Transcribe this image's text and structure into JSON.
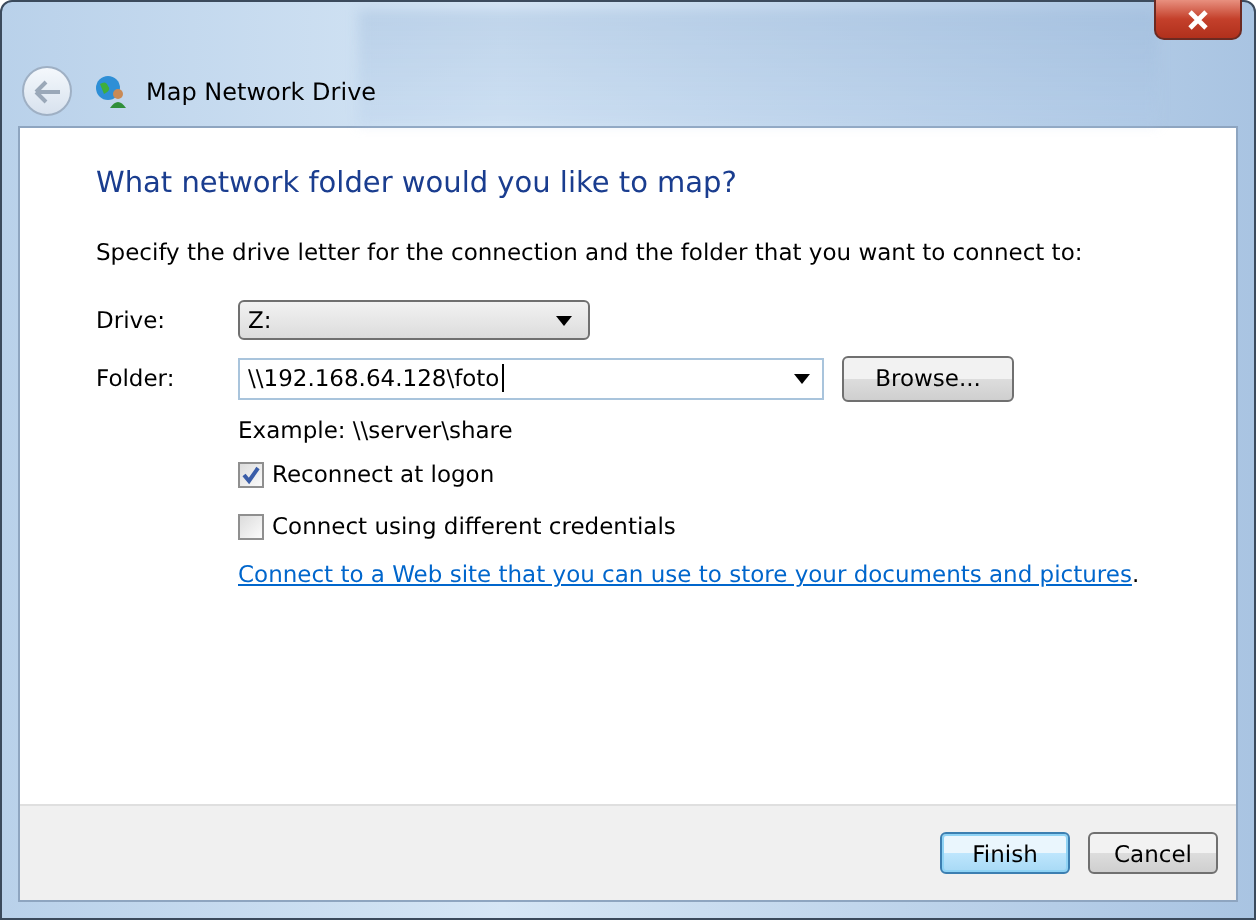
{
  "window": {
    "title": "Map Network Drive"
  },
  "heading": "What network folder would you like to map?",
  "instruction": "Specify the drive letter for the connection and the folder that you want to connect to:",
  "drive": {
    "label": "Drive:",
    "value": "Z:"
  },
  "folder": {
    "label": "Folder:",
    "value": "\\\\192.168.64.128\\foto",
    "browse": "Browse..."
  },
  "example": "Example: \\\\server\\share",
  "options": [
    {
      "label": "Reconnect at logon",
      "checked": true
    },
    {
      "label": "Connect using different credentials",
      "checked": false
    }
  ],
  "link": {
    "text": "Connect to a Web site that you can use to store your documents and pictures",
    "suffix": "."
  },
  "buttons": [
    {
      "label": "Finish",
      "default": true
    },
    {
      "label": "Cancel",
      "default": false
    }
  ]
}
